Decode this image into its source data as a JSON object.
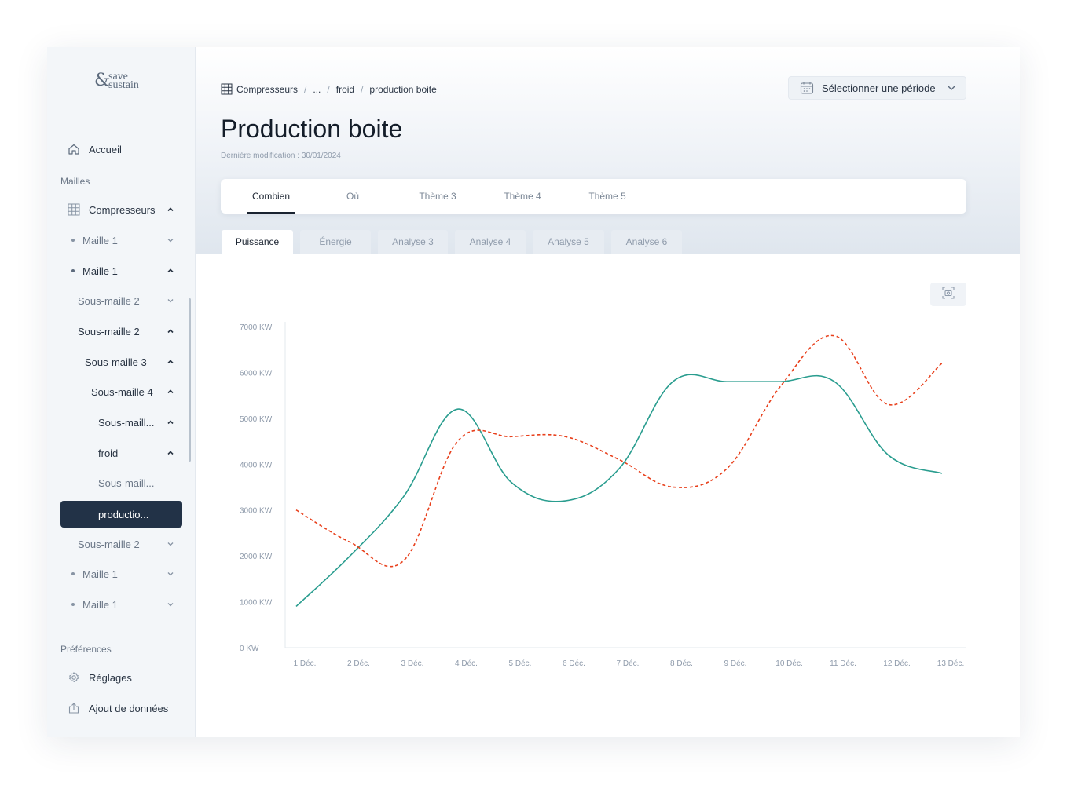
{
  "logo": {
    "amp": "&",
    "word1": "save",
    "word2": "sustain"
  },
  "sidebar": {
    "home": {
      "label": "Accueil",
      "icon": "home-icon"
    },
    "section_mailles": "Mailles",
    "items": [
      {
        "label": "Compresseurs",
        "icon": "grid-icon",
        "expanded": true
      },
      {
        "label": "Maille 1",
        "bullet": true,
        "expanded": false
      },
      {
        "label": "Maille 1",
        "bullet": true,
        "expanded": true
      },
      {
        "label": "Sous-maille 2",
        "expanded": false
      },
      {
        "label": "Sous-maille 2",
        "expanded": true
      },
      {
        "label": "Sous-maille 3",
        "expanded": true
      },
      {
        "label": "Sous-maille 4",
        "expanded": true
      },
      {
        "label": "Sous-maill...",
        "expanded": true
      },
      {
        "label": "froid",
        "expanded": true
      },
      {
        "label": "Sous-maill..."
      },
      {
        "label": "productio...",
        "active": true
      },
      {
        "label": "Sous-maille 2",
        "expanded": false
      },
      {
        "label": "Maille 1",
        "bullet": true,
        "expanded": false
      },
      {
        "label": "Maille 1",
        "bullet": true,
        "expanded": false
      }
    ],
    "section_preferences": "Préférences",
    "settings": {
      "label": "Réglages",
      "icon": "gear-icon"
    },
    "add_data": {
      "label": "Ajout de données",
      "icon": "upload-icon"
    }
  },
  "header": {
    "breadcrumb": [
      "Compresseurs",
      "...",
      "froid",
      "production boite"
    ],
    "period_label": "Sélectionner une période",
    "title": "Production boite",
    "last_modified": "Dernière modification : 30/01/2024"
  },
  "tabs": [
    {
      "label": "Combien",
      "active": true
    },
    {
      "label": "Où"
    },
    {
      "label": "Thème 3"
    },
    {
      "label": "Thème 4"
    },
    {
      "label": "Thème 5"
    }
  ],
  "subtabs": [
    {
      "label": "Puissance",
      "active": true
    },
    {
      "label": "Énergie"
    },
    {
      "label": "Analyse 3"
    },
    {
      "label": "Analyse 4"
    },
    {
      "label": "Analyse 5"
    },
    {
      "label": "Analyse 6"
    }
  ],
  "colors": {
    "accent_dark": "#223247",
    "series_teal": "#2a9d8f",
    "series_red": "#e8401c"
  },
  "chart_data": {
    "type": "line",
    "categories": [
      "1 Déc.",
      "2 Déc.",
      "3 Déc.",
      "4 Déc.",
      "5 Déc.",
      "6 Déc.",
      "7 Déc.",
      "8 Déc.",
      "9 Déc.",
      "10 Déc.",
      "11 Déc.",
      "12 Déc.",
      "13 Déc."
    ],
    "y_ticks": [
      "0 KW",
      "1000 KW",
      "2000 KW",
      "3000 KW",
      "4000 KW",
      "5000 KW",
      "6000 KW",
      "7000 KW"
    ],
    "ylim": [
      0,
      7000
    ],
    "grid": false,
    "series": [
      {
        "style": "solid",
        "color": "#2a9d8f",
        "values": [
          900,
          2000,
          3300,
          5200,
          3600,
          3200,
          3900,
          5800,
          5800,
          5800,
          5800,
          4200,
          3800
        ]
      },
      {
        "style": "dashed",
        "color": "#e8401c",
        "values": [
          3000,
          2300,
          1900,
          4500,
          4600,
          4600,
          4100,
          3500,
          3900,
          5700,
          6800,
          5300,
          6200
        ]
      }
    ]
  }
}
